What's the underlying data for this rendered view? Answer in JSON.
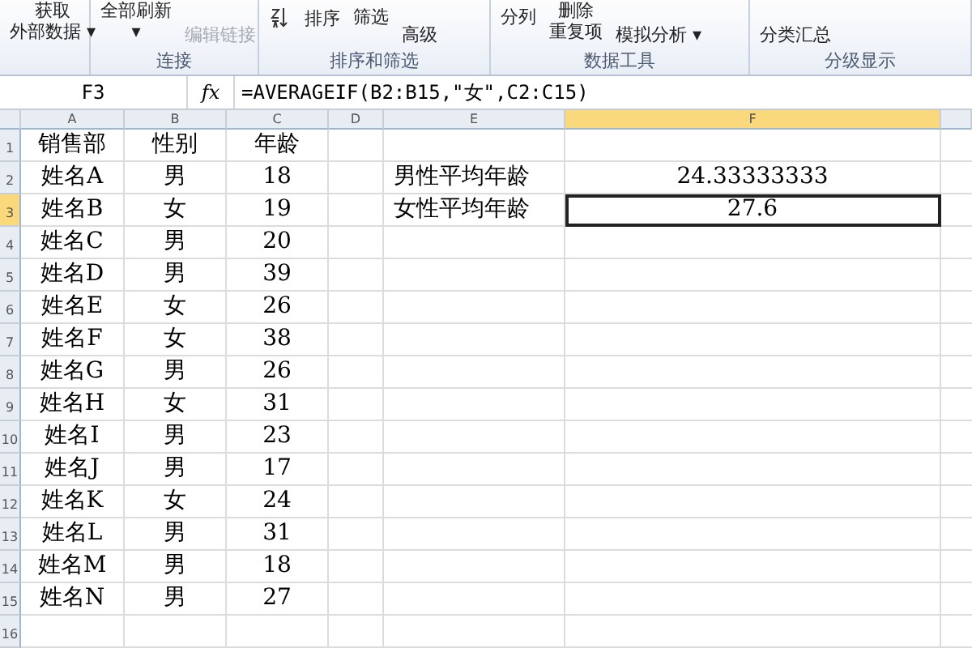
{
  "ribbon": {
    "groups": [
      {
        "items": [
          {
            "kind": "large",
            "text": "获取",
            "text2": "外部数据 ▾",
            "disabled": false
          }
        ]
      },
      {
        "label": "连接",
        "items": [
          {
            "kind": "large",
            "text": "全部刷新",
            "text2": "▾",
            "disabled": false
          },
          {
            "kind": "small",
            "text": "编辑链接",
            "disabled": true
          }
        ]
      },
      {
        "label": "排序和筛选",
        "items": [
          {
            "kind": "sorticon",
            "text": "排序",
            "disabled": false
          },
          {
            "kind": "plain",
            "text": "筛选",
            "disabled": false
          },
          {
            "kind": "small",
            "text": "高级",
            "disabled": false
          }
        ]
      },
      {
        "label": "数据工具",
        "items": [
          {
            "kind": "plain",
            "text": "分列",
            "disabled": false
          },
          {
            "kind": "large",
            "text": "删除",
            "text2": "重复项",
            "disabled": false
          },
          {
            "kind": "small",
            "text": "模拟分析 ▾",
            "disabled": false
          }
        ]
      },
      {
        "label": "分级显示",
        "items": [
          {
            "kind": "small",
            "text": "分类汇总",
            "disabled": false
          }
        ]
      }
    ]
  },
  "formula_bar": {
    "name_box": "F3",
    "fx": "fx",
    "formula": "=AVERAGEIF(B2:B15,\"女\",C2:C15)"
  },
  "columns": [
    {
      "label": "A",
      "selected": false
    },
    {
      "label": "B",
      "selected": false
    },
    {
      "label": "C",
      "selected": false
    },
    {
      "label": "D",
      "selected": false
    },
    {
      "label": "E",
      "selected": false
    },
    {
      "label": "F",
      "selected": true
    }
  ],
  "rows": [
    {
      "number": "1",
      "selected": false,
      "cells": [
        "销售部",
        "性别",
        "年龄",
        null,
        null,
        null
      ]
    },
    {
      "number": "2",
      "selected": false,
      "cells": [
        "姓名A",
        "男",
        "18",
        null,
        "男性平均年龄",
        "24.33333333"
      ]
    },
    {
      "number": "3",
      "selected": true,
      "cells": [
        "姓名B",
        "女",
        "19",
        null,
        "女性平均年龄",
        "27.6"
      ]
    },
    {
      "number": "4",
      "selected": false,
      "cells": [
        "姓名C",
        "男",
        "20",
        null,
        null,
        null
      ]
    },
    {
      "number": "5",
      "selected": false,
      "cells": [
        "姓名D",
        "男",
        "39",
        null,
        null,
        null
      ]
    },
    {
      "number": "6",
      "selected": false,
      "cells": [
        "姓名E",
        "女",
        "26",
        null,
        null,
        null
      ]
    },
    {
      "number": "7",
      "selected": false,
      "cells": [
        "姓名F",
        "女",
        "38",
        null,
        null,
        null
      ]
    },
    {
      "number": "8",
      "selected": false,
      "cells": [
        "姓名G",
        "男",
        "26",
        null,
        null,
        null
      ]
    },
    {
      "number": "9",
      "selected": false,
      "cells": [
        "姓名H",
        "女",
        "31",
        null,
        null,
        null
      ]
    },
    {
      "number": "10",
      "selected": false,
      "cells": [
        "姓名I",
        "男",
        "23",
        null,
        null,
        null
      ]
    },
    {
      "number": "11",
      "selected": false,
      "cells": [
        "姓名J",
        "男",
        "17",
        null,
        null,
        null
      ]
    },
    {
      "number": "12",
      "selected": false,
      "cells": [
        "姓名K",
        "女",
        "24",
        null,
        null,
        null
      ]
    },
    {
      "number": "13",
      "selected": false,
      "cells": [
        "姓名L",
        "男",
        "31",
        null,
        null,
        null
      ]
    },
    {
      "number": "14",
      "selected": false,
      "cells": [
        "姓名M",
        "男",
        "18",
        null,
        null,
        null
      ]
    },
    {
      "number": "15",
      "selected": false,
      "cells": [
        "姓名N",
        "男",
        "27",
        null,
        null,
        null
      ]
    },
    {
      "number": "16",
      "selected": false,
      "cells": [
        null,
        null,
        null,
        null,
        null,
        null
      ]
    }
  ]
}
